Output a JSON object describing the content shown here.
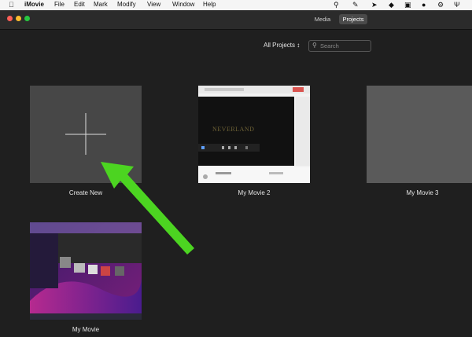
{
  "menubar": {
    "app_name": "iMovie",
    "items": [
      "File",
      "Edit",
      "Mark",
      "Modify",
      "View",
      "Window",
      "Help"
    ]
  },
  "toolbar": {
    "tabs": [
      "Media",
      "Projects"
    ],
    "active_tab": "Projects"
  },
  "filter": {
    "label": "All Projects ↕",
    "search_placeholder": "Search"
  },
  "projects": [
    {
      "label": "Create New"
    },
    {
      "label": "My Movie 2",
      "thumb_text": "NEVERLAND"
    },
    {
      "label": "My Movie 3"
    },
    {
      "label": "My Movie"
    }
  ],
  "colors": {
    "accent_arrow": "#4cd421"
  }
}
